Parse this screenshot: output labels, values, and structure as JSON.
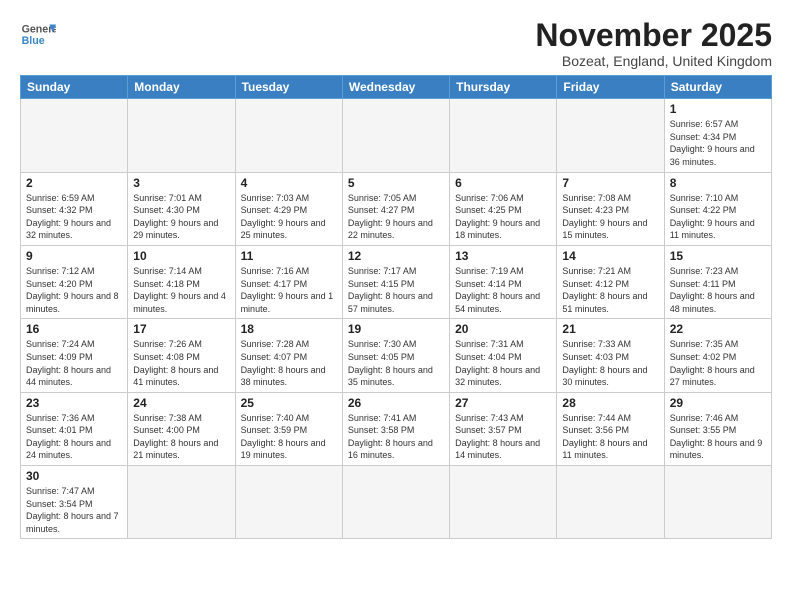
{
  "header": {
    "logo_general": "General",
    "logo_blue": "Blue",
    "month_title": "November 2025",
    "subtitle": "Bozeat, England, United Kingdom"
  },
  "weekdays": [
    "Sunday",
    "Monday",
    "Tuesday",
    "Wednesday",
    "Thursday",
    "Friday",
    "Saturday"
  ],
  "weeks": [
    [
      {
        "day": "",
        "empty": true
      },
      {
        "day": "",
        "empty": true
      },
      {
        "day": "",
        "empty": true
      },
      {
        "day": "",
        "empty": true
      },
      {
        "day": "",
        "empty": true
      },
      {
        "day": "",
        "empty": true
      },
      {
        "day": "1",
        "sunrise": "6:57 AM",
        "sunset": "4:34 PM",
        "daylight": "9 hours and 36 minutes."
      }
    ],
    [
      {
        "day": "2",
        "sunrise": "6:59 AM",
        "sunset": "4:32 PM",
        "daylight": "9 hours and 32 minutes."
      },
      {
        "day": "3",
        "sunrise": "7:01 AM",
        "sunset": "4:30 PM",
        "daylight": "9 hours and 29 minutes."
      },
      {
        "day": "4",
        "sunrise": "7:03 AM",
        "sunset": "4:29 PM",
        "daylight": "9 hours and 25 minutes."
      },
      {
        "day": "5",
        "sunrise": "7:05 AM",
        "sunset": "4:27 PM",
        "daylight": "9 hours and 22 minutes."
      },
      {
        "day": "6",
        "sunrise": "7:06 AM",
        "sunset": "4:25 PM",
        "daylight": "9 hours and 18 minutes."
      },
      {
        "day": "7",
        "sunrise": "7:08 AM",
        "sunset": "4:23 PM",
        "daylight": "9 hours and 15 minutes."
      },
      {
        "day": "8",
        "sunrise": "7:10 AM",
        "sunset": "4:22 PM",
        "daylight": "9 hours and 11 minutes."
      }
    ],
    [
      {
        "day": "9",
        "sunrise": "7:12 AM",
        "sunset": "4:20 PM",
        "daylight": "9 hours and 8 minutes."
      },
      {
        "day": "10",
        "sunrise": "7:14 AM",
        "sunset": "4:18 PM",
        "daylight": "9 hours and 4 minutes."
      },
      {
        "day": "11",
        "sunrise": "7:16 AM",
        "sunset": "4:17 PM",
        "daylight": "9 hours and 1 minute."
      },
      {
        "day": "12",
        "sunrise": "7:17 AM",
        "sunset": "4:15 PM",
        "daylight": "8 hours and 57 minutes."
      },
      {
        "day": "13",
        "sunrise": "7:19 AM",
        "sunset": "4:14 PM",
        "daylight": "8 hours and 54 minutes."
      },
      {
        "day": "14",
        "sunrise": "7:21 AM",
        "sunset": "4:12 PM",
        "daylight": "8 hours and 51 minutes."
      },
      {
        "day": "15",
        "sunrise": "7:23 AM",
        "sunset": "4:11 PM",
        "daylight": "8 hours and 48 minutes."
      }
    ],
    [
      {
        "day": "16",
        "sunrise": "7:24 AM",
        "sunset": "4:09 PM",
        "daylight": "8 hours and 44 minutes."
      },
      {
        "day": "17",
        "sunrise": "7:26 AM",
        "sunset": "4:08 PM",
        "daylight": "8 hours and 41 minutes."
      },
      {
        "day": "18",
        "sunrise": "7:28 AM",
        "sunset": "4:07 PM",
        "daylight": "8 hours and 38 minutes."
      },
      {
        "day": "19",
        "sunrise": "7:30 AM",
        "sunset": "4:05 PM",
        "daylight": "8 hours and 35 minutes."
      },
      {
        "day": "20",
        "sunrise": "7:31 AM",
        "sunset": "4:04 PM",
        "daylight": "8 hours and 32 minutes."
      },
      {
        "day": "21",
        "sunrise": "7:33 AM",
        "sunset": "4:03 PM",
        "daylight": "8 hours and 30 minutes."
      },
      {
        "day": "22",
        "sunrise": "7:35 AM",
        "sunset": "4:02 PM",
        "daylight": "8 hours and 27 minutes."
      }
    ],
    [
      {
        "day": "23",
        "sunrise": "7:36 AM",
        "sunset": "4:01 PM",
        "daylight": "8 hours and 24 minutes."
      },
      {
        "day": "24",
        "sunrise": "7:38 AM",
        "sunset": "4:00 PM",
        "daylight": "8 hours and 21 minutes."
      },
      {
        "day": "25",
        "sunrise": "7:40 AM",
        "sunset": "3:59 PM",
        "daylight": "8 hours and 19 minutes."
      },
      {
        "day": "26",
        "sunrise": "7:41 AM",
        "sunset": "3:58 PM",
        "daylight": "8 hours and 16 minutes."
      },
      {
        "day": "27",
        "sunrise": "7:43 AM",
        "sunset": "3:57 PM",
        "daylight": "8 hours and 14 minutes."
      },
      {
        "day": "28",
        "sunrise": "7:44 AM",
        "sunset": "3:56 PM",
        "daylight": "8 hours and 11 minutes."
      },
      {
        "day": "29",
        "sunrise": "7:46 AM",
        "sunset": "3:55 PM",
        "daylight": "8 hours and 9 minutes."
      }
    ],
    [
      {
        "day": "30",
        "sunrise": "7:47 AM",
        "sunset": "3:54 PM",
        "daylight": "8 hours and 7 minutes."
      },
      {
        "day": "",
        "empty": true
      },
      {
        "day": "",
        "empty": true
      },
      {
        "day": "",
        "empty": true
      },
      {
        "day": "",
        "empty": true
      },
      {
        "day": "",
        "empty": true
      },
      {
        "day": "",
        "empty": true
      }
    ]
  ],
  "labels": {
    "sunrise": "Sunrise:",
    "sunset": "Sunset:",
    "daylight": "Daylight:"
  }
}
